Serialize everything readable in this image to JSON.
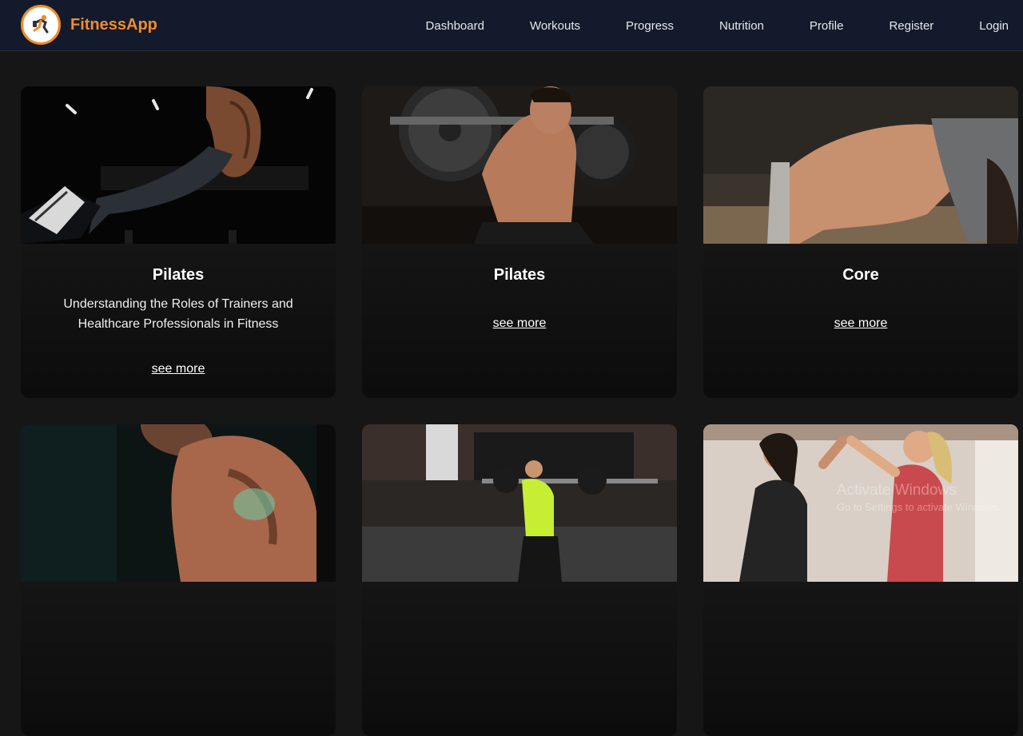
{
  "header": {
    "brand": "FitnessApp",
    "logo_icon": "runner-logo-icon",
    "nav": [
      "Dashboard",
      "Workouts",
      "Progress",
      "Nutrition",
      "Profile",
      "Register",
      "Login"
    ]
  },
  "cards": [
    {
      "image": "athlete-jump-photo",
      "title": "Pilates",
      "description": "Understanding the Roles of Trainers and Healthcare Professionals in Fitness",
      "link": "see more"
    },
    {
      "image": "barbell-squat-photo",
      "title": "Pilates",
      "description": "",
      "link": "see more"
    },
    {
      "image": "pushup-photo",
      "title": "Core",
      "description": "",
      "link": "see more"
    },
    {
      "image": "muscular-back-photo"
    },
    {
      "image": "gym-squat-woman-photo"
    },
    {
      "image": "high-five-photo"
    }
  ],
  "watermark": {
    "line1": "Activate Windows",
    "line2": "Go to Settings to activate Windows."
  },
  "colors": {
    "accent": "#f28b2c",
    "navbar": "#131a2b",
    "background": "#161616"
  }
}
